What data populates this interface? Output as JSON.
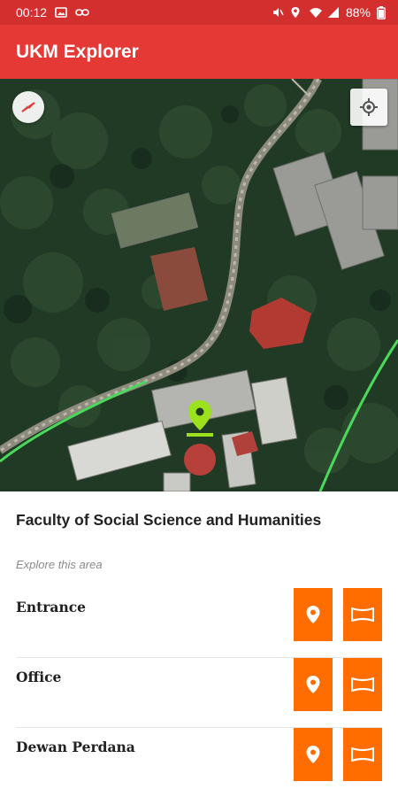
{
  "status_bar": {
    "time": "00:12",
    "battery": "88%",
    "left_icons": [
      "image-icon",
      "link-icon"
    ],
    "right_icons": [
      "mute-icon",
      "location-icon",
      "wifi-icon",
      "signal-icon",
      "battery-icon"
    ]
  },
  "app_bar": {
    "title": "UKM Explorer",
    "color": "#e53935"
  },
  "map": {
    "type": "satellite",
    "compass_icon": "compass-icon",
    "locate_icon": "my-location-icon",
    "marker_color": "#9be21c"
  },
  "place": {
    "title": "Faculty of Social Science and Humanities",
    "section_label": "Explore this area",
    "items": [
      {
        "name": "Entrance",
        "location_icon": "map-pin-icon",
        "view_icon": "panorama-icon"
      },
      {
        "name": "Office",
        "location_icon": "map-pin-icon",
        "view_icon": "panorama-icon"
      },
      {
        "name": "Dewan Perdana",
        "location_icon": "map-pin-icon",
        "view_icon": "panorama-icon"
      }
    ],
    "button_color": "#ff6d00"
  }
}
